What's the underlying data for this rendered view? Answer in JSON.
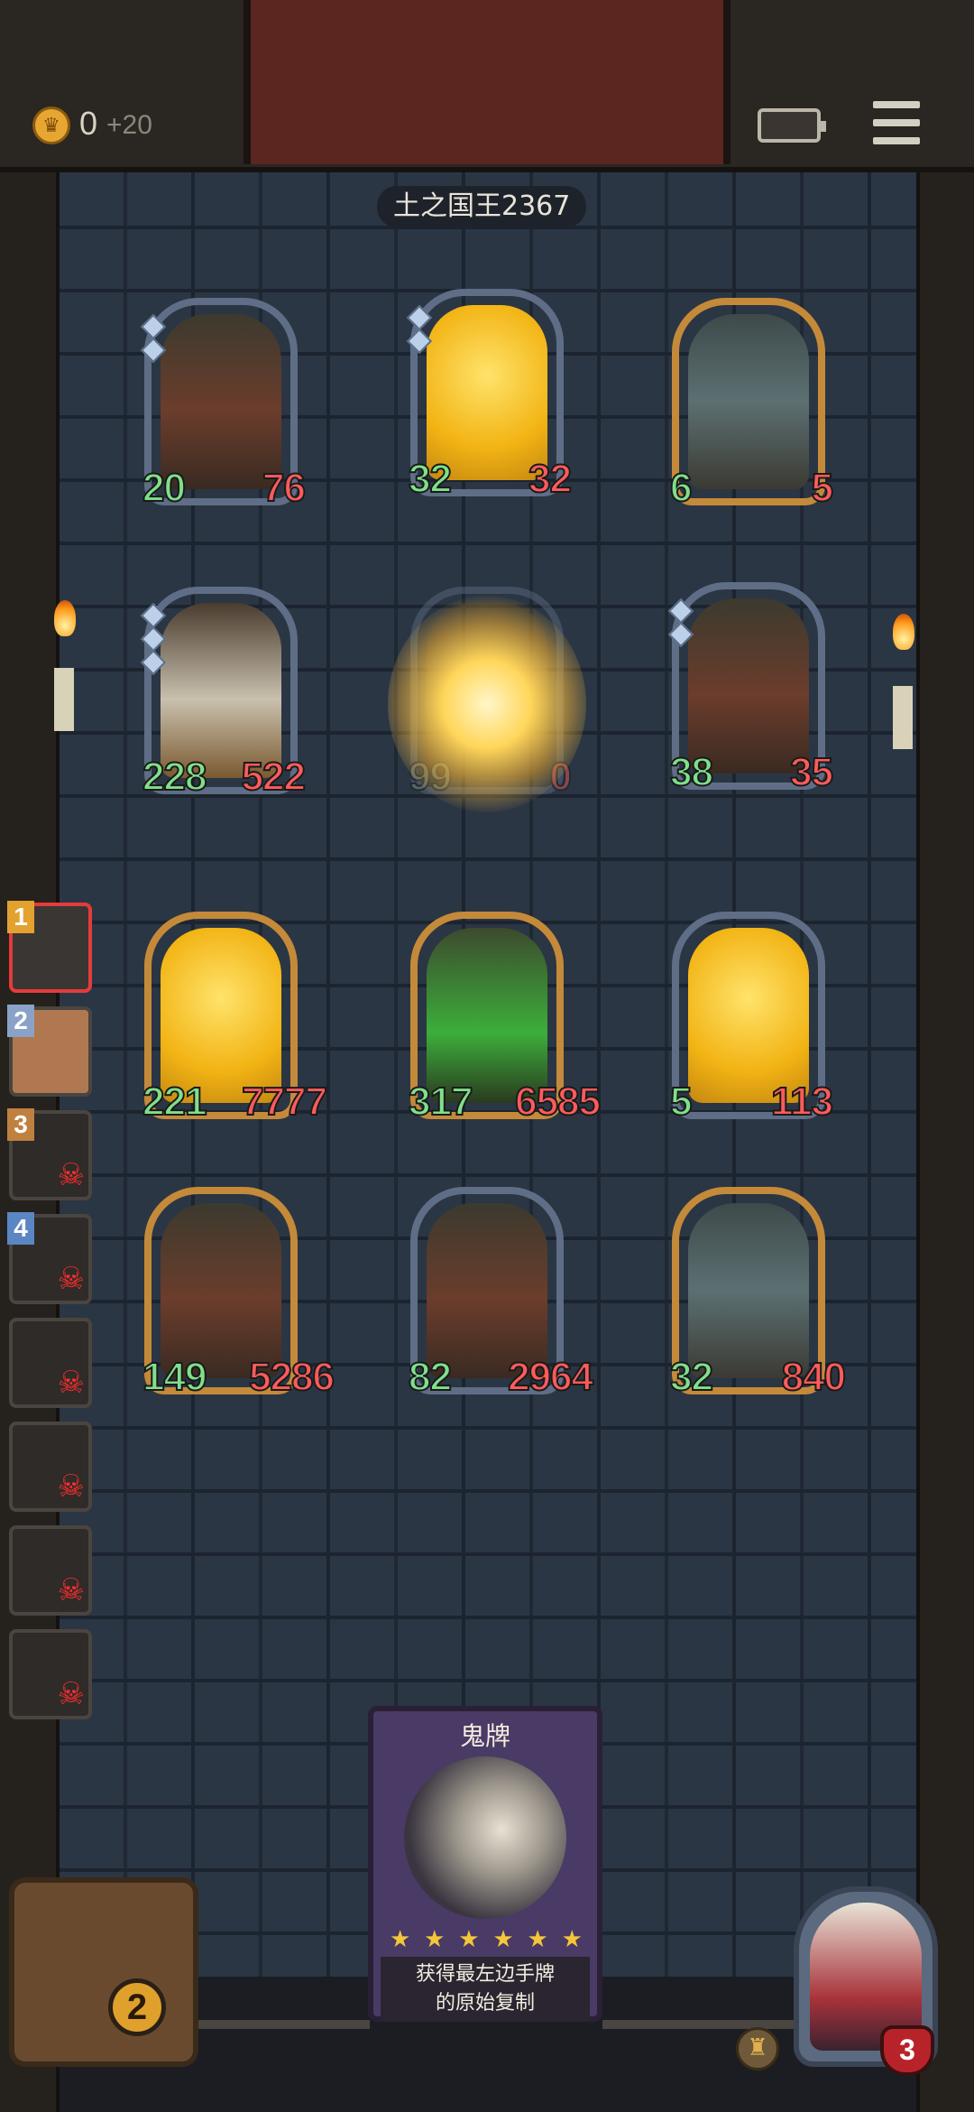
{
  "hud": {
    "gold": "0",
    "gold_bonus": "+20"
  },
  "level_title": "土之国王2367",
  "enemy_cards": [
    {
      "attack": "20",
      "health": "76",
      "art": "dragon"
    },
    {
      "attack": "32",
      "health": "32",
      "art": "gold"
    },
    {
      "attack": "6",
      "health": "5",
      "art": "beast"
    },
    {
      "attack": "228",
      "health": "522",
      "art": "pumpkin"
    },
    {
      "attack": "99",
      "health": "0",
      "art": "exploding"
    },
    {
      "attack": "38",
      "health": "35",
      "art": "dragon"
    }
  ],
  "player_cards": [
    {
      "attack": "221",
      "health": "7777",
      "art": "gold"
    },
    {
      "attack": "317",
      "health": "6585",
      "art": "green"
    },
    {
      "attack": "5",
      "health": "113",
      "art": "gold"
    },
    {
      "attack": "149",
      "health": "5286",
      "art": "dragon"
    },
    {
      "attack": "82",
      "health": "2964",
      "art": "dragon"
    },
    {
      "attack": "32",
      "health": "840",
      "art": "beast"
    }
  ],
  "turn_queue": [
    "1",
    "2",
    "3",
    "4"
  ],
  "skull_icon": "☠",
  "ghost_card": {
    "title": "鬼牌",
    "stars": [
      "★",
      "★",
      "★",
      "★",
      "★",
      "★"
    ],
    "description_line1": "获得最左边手牌",
    "description_line2": "的原始复制"
  },
  "deck_count": "2",
  "hero_health": "3",
  "colors": {
    "attack": "#7fe08a",
    "health": "#ff5b5b",
    "accent_gold": "#e7a632"
  }
}
